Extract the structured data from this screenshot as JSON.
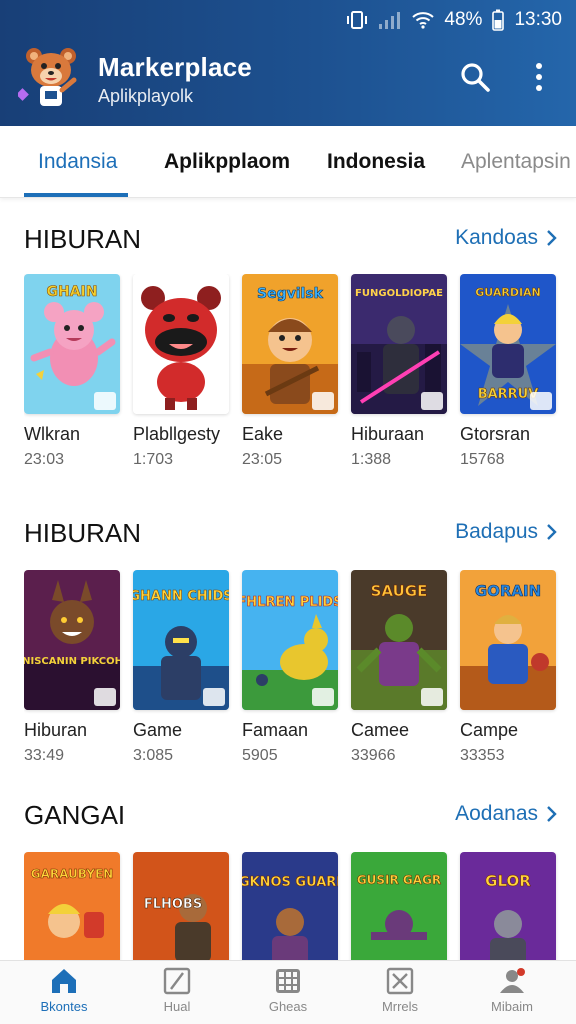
{
  "status": {
    "battery": "48%",
    "time": "13:30"
  },
  "header": {
    "title": "Markerplace",
    "subtitle": "Aplikplayolk"
  },
  "tabs": [
    {
      "label": "Indansia",
      "active": true
    },
    {
      "label": "Aplikpplaom"
    },
    {
      "label": "Indonesia"
    },
    {
      "label": "Aplentapsin"
    }
  ],
  "sections": [
    {
      "title": "HIBURAN",
      "more": "Kandoas",
      "items": [
        {
          "name": "Wlkran",
          "count": "23:03",
          "art": "GHAIN"
        },
        {
          "name": "Plabllgesty",
          "count": "1:703",
          "art": ""
        },
        {
          "name": "Eake",
          "count": "23:05",
          "art": "Segvilsk"
        },
        {
          "name": "Hiburaan",
          "count": "1:388",
          "art": "FUNGOLDIOPAE"
        },
        {
          "name": "Gtorsran",
          "count": "15768",
          "art": "GUARDIAN"
        }
      ]
    },
    {
      "title": "HIBURAN",
      "more": "Badapus",
      "items": [
        {
          "name": "Hiburan",
          "count": "33:49",
          "art": "DNISCANIN PIKCOHS"
        },
        {
          "name": "Game",
          "count": "3:085",
          "art": "GHANN CHIDS"
        },
        {
          "name": "Famaan",
          "count": "5905",
          "art": "FHLREN PLIDS"
        },
        {
          "name": "Camee",
          "count": "33966",
          "art": "SAUGE"
        },
        {
          "name": "Campe",
          "count": "33353",
          "art": "GORAIN"
        }
      ]
    },
    {
      "title": "GANGAI",
      "more": "Aodanas",
      "items": [
        {
          "name": "",
          "count": "",
          "art": "GARAUBYEN"
        },
        {
          "name": "",
          "count": "",
          "art": "FLHOBS"
        },
        {
          "name": "",
          "count": "",
          "art": "GKNOS GUARI"
        },
        {
          "name": "",
          "count": "",
          "art": "GUSIR GAGR"
        },
        {
          "name": "",
          "count": "",
          "art": "GLOR"
        }
      ]
    }
  ],
  "bottom_nav": [
    {
      "label": "Bkontes",
      "icon": "home-icon",
      "active": true
    },
    {
      "label": "Hual",
      "icon": "split-square-icon"
    },
    {
      "label": "Gheas",
      "icon": "grid-icon"
    },
    {
      "label": "Mrrels",
      "icon": "box-x-icon"
    },
    {
      "label": "Mibaim",
      "icon": "profile-icon"
    }
  ],
  "colors": {
    "header": "#1d5190",
    "accent": "#1d6fb8",
    "link": "#1e6fb5"
  }
}
